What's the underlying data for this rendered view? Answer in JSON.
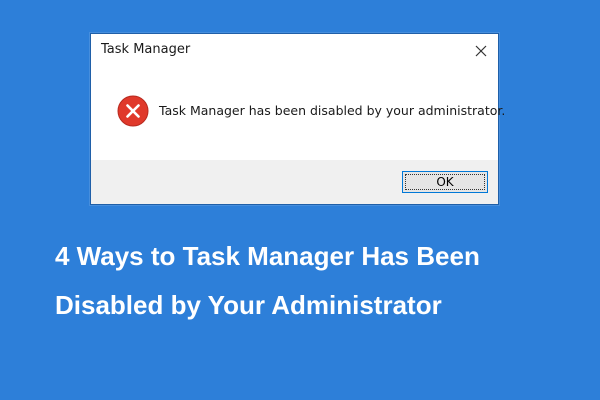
{
  "dialog": {
    "title": "Task Manager",
    "close_icon": "close-icon",
    "error_icon": "error-circle-icon",
    "message": "Task Manager has been disabled by your administrator.",
    "ok_label": "OK"
  },
  "headline": {
    "line1": "4 Ways to Task Manager Has Been",
    "line2": "Disabled by Your Administrator"
  },
  "colors": {
    "background": "#2d7fd9",
    "error_red": "#e0392b",
    "button_border": "#0078d7",
    "footer_bg": "#f0f0f0"
  }
}
